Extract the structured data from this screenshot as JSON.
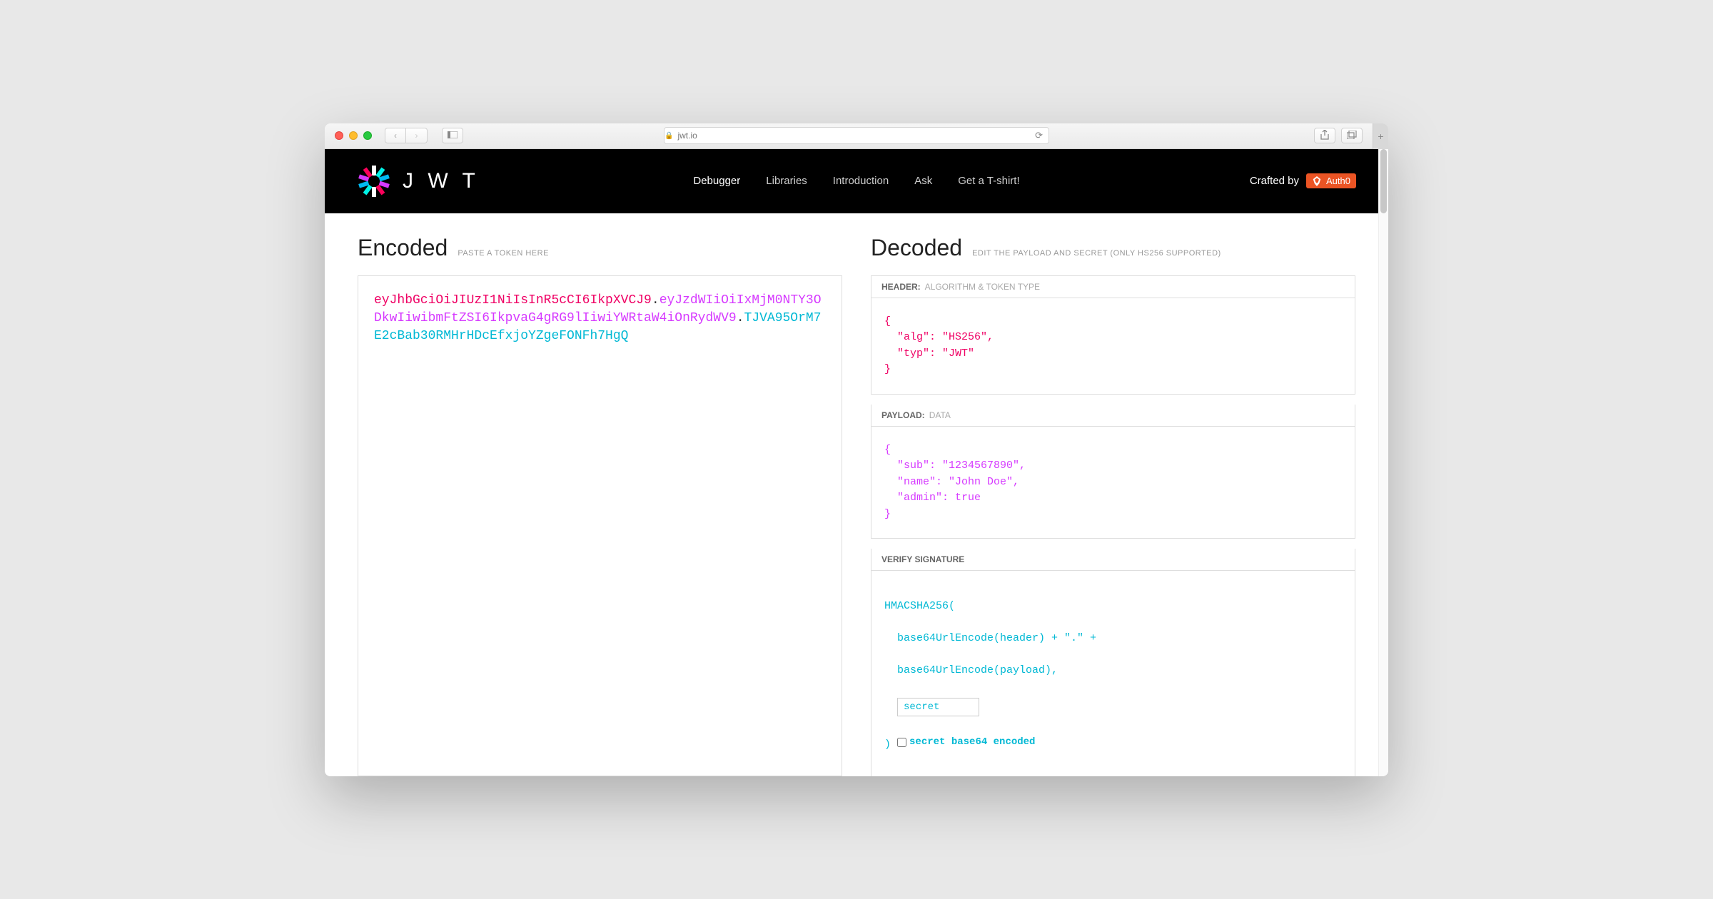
{
  "browser": {
    "url_host": "jwt.io"
  },
  "header": {
    "brand": "J W T",
    "nav": {
      "debugger": "Debugger",
      "libraries": "Libraries",
      "introduction": "Introduction",
      "ask": "Ask",
      "tshirt": "Get a T-shirt!"
    },
    "crafted_prefix": "Crafted by",
    "crafted_brand": "Auth0"
  },
  "encoded": {
    "title": "Encoded",
    "hint": "PASTE A TOKEN HERE",
    "token_header": "eyJhbGciOiJIUzI1NiIsInR5cCI6IkpXVCJ9",
    "token_payload": "eyJzdWIiOiIxMjM0NTY3ODkwIiwibmFtZSI6IkpvaG4gRG9lIiwiYWRtaW4iOnRydWV9",
    "token_sig": "TJVA95OrM7E2cBab30RMHrHDcEfxjoYZgeFONFh7HgQ"
  },
  "decoded": {
    "title": "Decoded",
    "hint": "EDIT THE PAYLOAD AND SECRET (ONLY HS256 SUPPORTED)",
    "header_label": "HEADER:",
    "header_sub": "ALGORITHM & TOKEN TYPE",
    "header_json": "{\n  \"alg\": \"HS256\",\n  \"typ\": \"JWT\"\n}",
    "payload_label": "PAYLOAD:",
    "payload_sub": "DATA",
    "payload_json": "{\n  \"sub\": \"1234567890\",\n  \"name\": \"John Doe\",\n  \"admin\": true\n}",
    "sig_label": "VERIFY SIGNATURE",
    "sig_line1": "HMACSHA256(",
    "sig_line2": "  base64UrlEncode(header) + \".\" +",
    "sig_line3": "  base64UrlEncode(payload),",
    "sig_secret_value": "secret",
    "sig_close": ")",
    "sig_check_label": "secret base64 encoded"
  }
}
